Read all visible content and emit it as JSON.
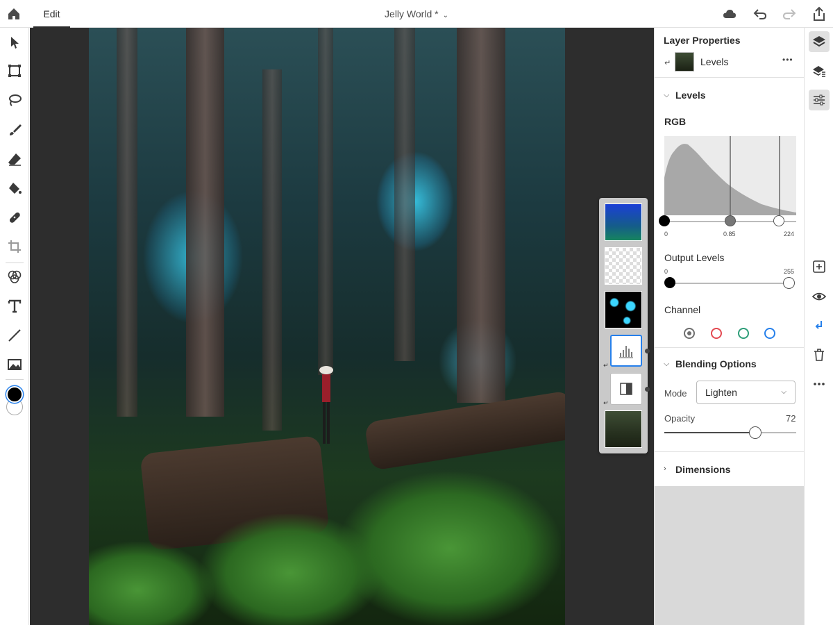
{
  "topbar": {
    "edit_tab": "Edit",
    "document_title": "Jelly World *",
    "title_chevron": "⌄"
  },
  "layer_properties": {
    "header": "Layer Properties",
    "layer_name": "Levels",
    "more": "•••"
  },
  "levels": {
    "section_title": "Levels",
    "channel_label": "RGB",
    "input_black": "0",
    "input_gamma": "0.85",
    "input_white": "224",
    "output_label": "Output Levels",
    "output_black": "0",
    "output_white": "255",
    "channel_title": "Channel",
    "channels": [
      "RGB",
      "Red",
      "Green",
      "Blue"
    ],
    "channel_colors": [
      "#6e6e6e",
      "#e34850",
      "#2d9d78",
      "#2680eb"
    ]
  },
  "blending": {
    "section_title": "Blending Options",
    "mode_label": "Mode",
    "mode_value": "Lighten",
    "opacity_label": "Opacity",
    "opacity_value": "72"
  },
  "dimensions": {
    "section_title": "Dimensions"
  },
  "colors": {
    "accent": "#2680eb",
    "foreground": "#000000",
    "background": "#ffffff"
  }
}
